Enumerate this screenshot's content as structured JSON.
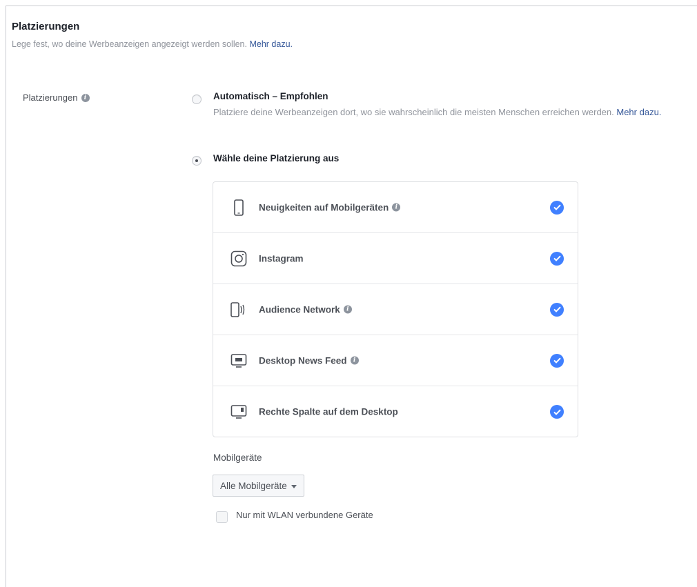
{
  "section": {
    "title": "Platzierungen",
    "description": "Lege fest, wo deine Werbeanzeigen angezeigt werden sollen.",
    "learn_more": "Mehr dazu."
  },
  "placements_field": {
    "label": "Platzierungen",
    "info_icon": "info-icon"
  },
  "options": {
    "automatic": {
      "title": "Automatisch – Empfohlen",
      "description": "Platziere deine Werbeanzeigen dort, wo sie wahrscheinlich die meisten Menschen erreichen werden.",
      "learn_more": "Mehr dazu.",
      "selected": false
    },
    "manual": {
      "title": "Wähle deine Platzierung aus",
      "selected": true
    }
  },
  "placement_items": [
    {
      "label": "Neuigkeiten auf Mobilgeräten",
      "icon": "mobile-phone-icon",
      "has_info": true,
      "checked": true
    },
    {
      "label": "Instagram",
      "icon": "instagram-icon",
      "has_info": false,
      "checked": true
    },
    {
      "label": "Audience Network",
      "icon": "audience-network-icon",
      "has_info": true,
      "checked": true
    },
    {
      "label": "Desktop News Feed",
      "icon": "desktop-monitor-icon",
      "has_info": true,
      "checked": true
    },
    {
      "label": "Rechte Spalte auf dem Desktop",
      "icon": "desktop-right-column-icon",
      "has_info": false,
      "checked": true
    }
  ],
  "mobile_devices": {
    "label": "Mobilgeräte",
    "dropdown_value": "Alle Mobilgeräte",
    "wifi_only_label": "Nur mit WLAN verbundene Geräte",
    "wifi_only_checked": false
  },
  "colors": {
    "link": "#365899",
    "check_blue": "#4080ff",
    "muted_text": "#90949c",
    "body_text": "#4b4f56"
  }
}
